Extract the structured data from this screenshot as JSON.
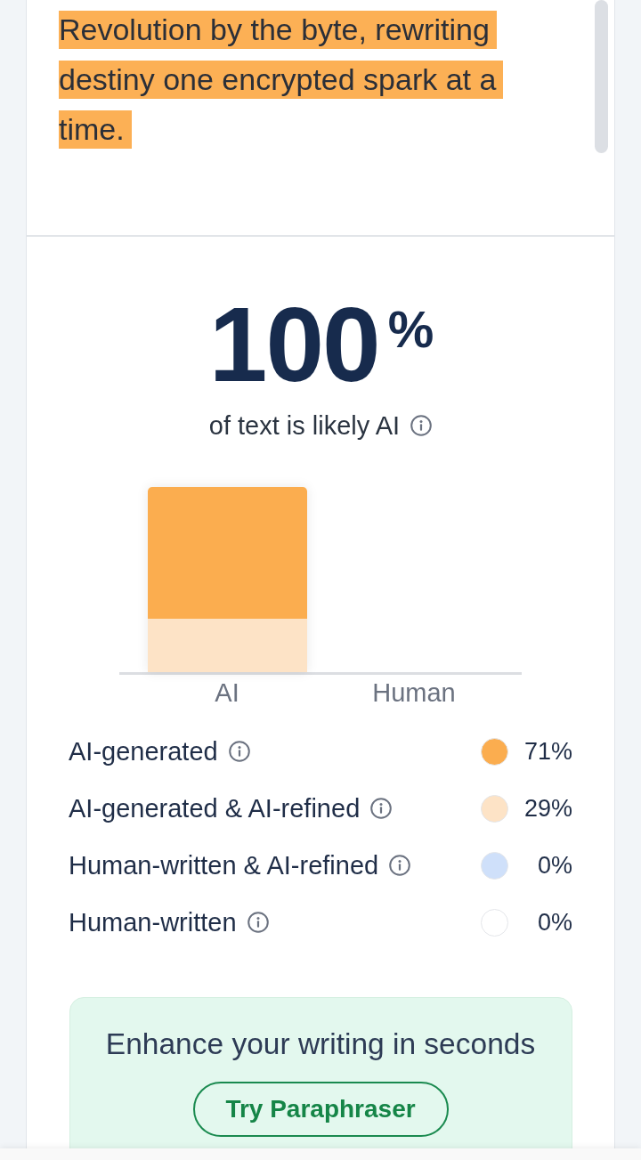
{
  "passage": {
    "lines": [
      {
        "text": "Revolution by the byte, rewriting",
        "highlighted": true
      },
      {
        "text": "destiny one encrypted spark at a",
        "highlighted": true
      },
      {
        "text": "time.",
        "highlighted": true
      }
    ]
  },
  "score": {
    "value": "100$^{%}$",
    "caption": "of text is likely AI"
  },
  "chart": {
    "labels": [
      "AI",
      "Human"
    ]
  },
  "breakdown": [
    {
      "label": "AI-generated",
      "color": "#fbad4f",
      "percent": "71%"
    },
    {
      "label": "AI-generated & AI-refined",
      "color": "#fde3c6",
      "percent": "29%"
    },
    {
      "label": "Human-written & AI-refined",
      "color": "#cfe0fa",
      "percent": "0%"
    },
    {
      "label": "Human-written",
      "color": "#ffffff",
      "percent": "0%"
    }
  ],
  "promo": {
    "title": "Enhance your writing in seconds",
    "button": "Try Paraphraser"
  }
}
